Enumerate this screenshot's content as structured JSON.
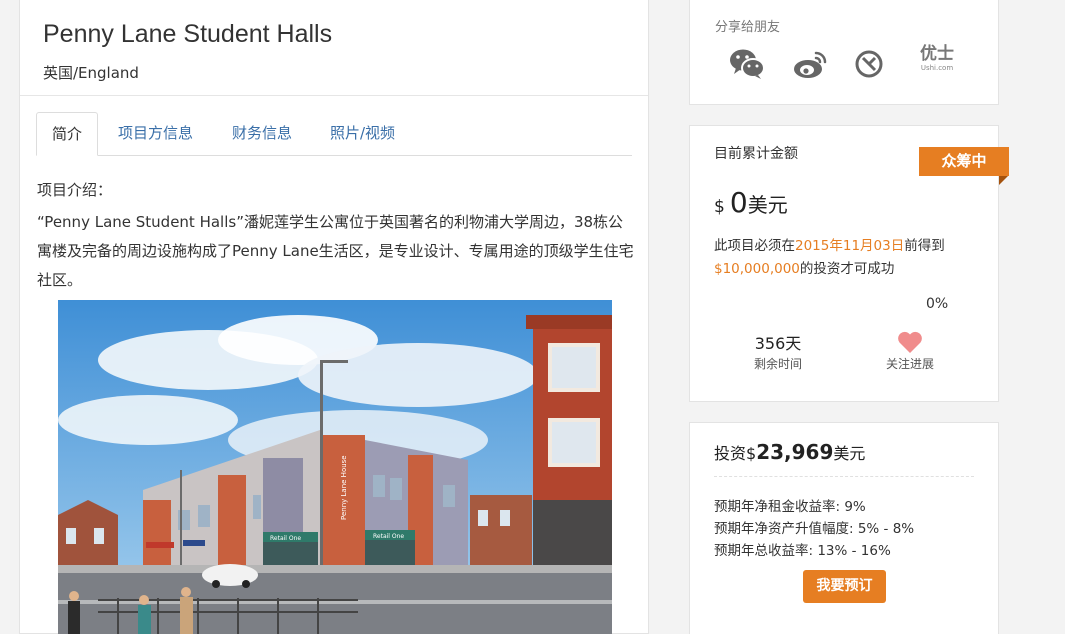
{
  "project": {
    "title": "Penny Lane Student Halls",
    "location": "英国/England"
  },
  "tabs": [
    "简介",
    "项目方信息",
    "财务信息",
    "照片/视频"
  ],
  "intro": {
    "label": "项目介绍：",
    "description": "“Penny Lane Student Halls”潘妮莲学生公寓位于英国著名的利物浦大学周边，38栋公寓楼及完备的周边设施构成了Penny Lane生活区，是专业设计、专属用途的顶级学生住宅社区。"
  },
  "photo_signs": {
    "building": "Penny Lane House",
    "retail": "Retail One"
  },
  "share": {
    "label": "分享给朋友",
    "icons": [
      "wechat-icon",
      "weibo-icon",
      "circle-share-icon",
      "ushi-icon"
    ],
    "ushi_main": "优士",
    "ushi_sub": "Ushi.com"
  },
  "funding": {
    "label": "目前累计金额",
    "status": "众筹中",
    "currency": "$",
    "amount": "0",
    "unit": "美元",
    "cond_pre": "此项目必须在",
    "deadline": "2015年11月03日",
    "cond_mid": "前得到",
    "target": "$10,000,000",
    "cond_post": "的投资才可成功",
    "percent": "0%",
    "days_left": "356天",
    "days_label": "剩余时间",
    "follow_label": "关注进展"
  },
  "invest": {
    "prefix": "投资$",
    "amount": "23,969",
    "unit": "美元",
    "rates": [
      "预期年净租金收益率:   9%",
      "预期年净资产升值幅度:   5% - 8%",
      "预期年总收益率:  13% - 16%"
    ],
    "button": "我要预订"
  },
  "colors": {
    "accent": "#e67e22",
    "link": "#3a6fa8"
  }
}
